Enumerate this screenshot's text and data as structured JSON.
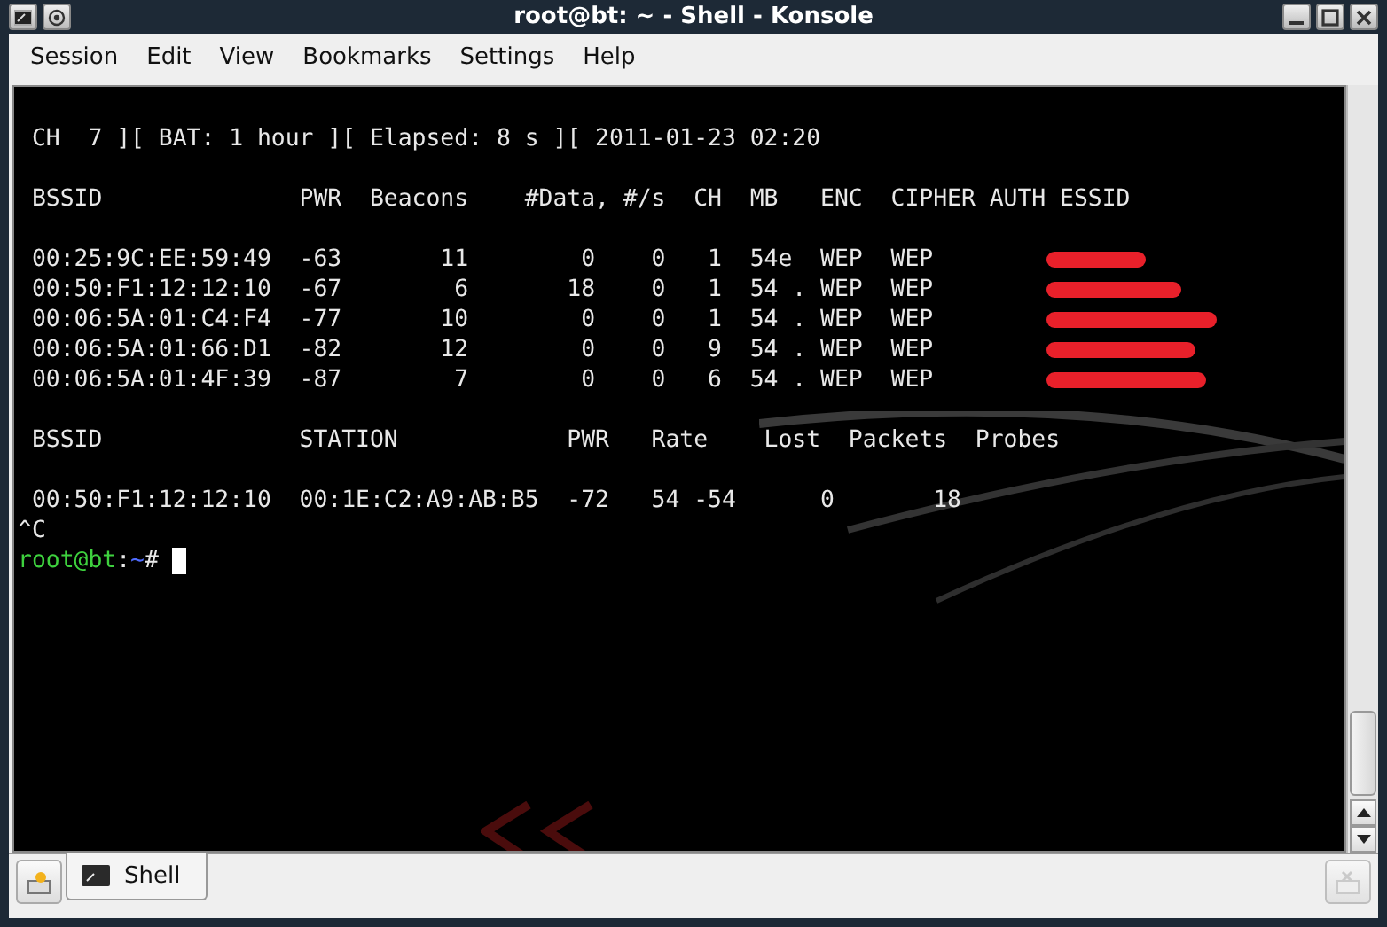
{
  "window": {
    "title": "root@bt: ~ - Shell - Konsole"
  },
  "menu": [
    "Session",
    "Edit",
    "View",
    "Bookmarks",
    "Settings",
    "Help"
  ],
  "terminal": {
    "lines": [
      {
        "kind": "blank"
      },
      {
        "kind": "text",
        "text": " CH  7 ][ BAT: 1 hour ][ Elapsed: 8 s ][ 2011-01-23 02:20"
      },
      {
        "kind": "blank"
      },
      {
        "kind": "text",
        "text": " BSSID              PWR  Beacons    #Data, #/s  CH  MB   ENC  CIPHER AUTH ESSID"
      },
      {
        "kind": "blank"
      },
      {
        "kind": "redacted",
        "text": " 00:25:9C:EE:59:49  -63       11        0    0   1  54e  WEP  WEP"
      },
      {
        "kind": "redacted",
        "text": " 00:50:F1:12:12:10  -67        6       18    0   1  54 . WEP  WEP"
      },
      {
        "kind": "redacted",
        "text": " 00:06:5A:01:C4:F4  -77       10        0    0   1  54 . WEP  WEP"
      },
      {
        "kind": "redacted",
        "text": " 00:06:5A:01:66:D1  -82       12        0    0   9  54 . WEP  WEP"
      },
      {
        "kind": "redacted",
        "text": " 00:06:5A:01:4F:39  -87        7        0    0   6  54 . WEP  WEP"
      },
      {
        "kind": "blank"
      },
      {
        "kind": "text",
        "text": " BSSID              STATION            PWR   Rate    Lost  Packets  Probes"
      },
      {
        "kind": "blank"
      },
      {
        "kind": "text",
        "text": " 00:50:F1:12:12:10  00:1E:C2:A9:AB:B5  -72   54 -54      0       18"
      },
      {
        "kind": "text",
        "text": "^C"
      }
    ],
    "prompt": {
      "user_host": "root@bt",
      "separator": ":",
      "path": "~",
      "symbol": "#"
    }
  },
  "tabs": [
    {
      "label": "Shell",
      "selected": true
    }
  ]
}
